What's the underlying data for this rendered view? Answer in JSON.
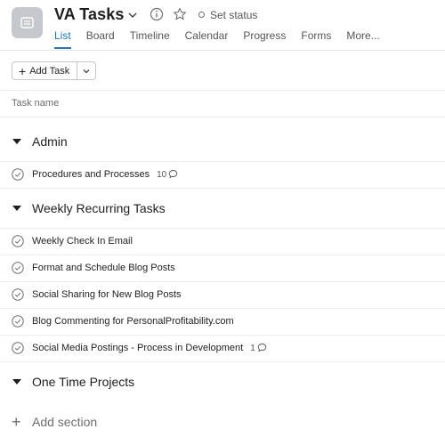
{
  "project": {
    "title": "VA Tasks",
    "set_status": "Set status"
  },
  "tabs": [
    {
      "label": "List",
      "active": true
    },
    {
      "label": "Board"
    },
    {
      "label": "Timeline"
    },
    {
      "label": "Calendar"
    },
    {
      "label": "Progress"
    },
    {
      "label": "Forms"
    },
    {
      "label": "More..."
    }
  ],
  "toolbar": {
    "add_task_label": "Add Task"
  },
  "list": {
    "column_header": "Task name"
  },
  "sections": [
    {
      "title": "Admin",
      "tasks": [
        {
          "name": "Procedures and Processes",
          "comments": "10"
        }
      ]
    },
    {
      "title": "Weekly Recurring Tasks",
      "tasks": [
        {
          "name": "Weekly Check In Email"
        },
        {
          "name": "Format and Schedule Blog Posts"
        },
        {
          "name": "Social Sharing for New Blog Posts"
        },
        {
          "name": "Blog Commenting for PersonalProfitability.com"
        },
        {
          "name": "Social Media Postings - Process in Development",
          "comments": "1"
        }
      ]
    },
    {
      "title": "One Time Projects",
      "tasks": []
    }
  ],
  "footer": {
    "add_section_label": "Add section"
  },
  "icons": {
    "project": "list-project-icon",
    "title_menu": "chevron-down-icon",
    "info": "info-icon",
    "favorite": "star-icon",
    "status": "status-circle-icon",
    "add": "plus-icon",
    "dropdown": "chevron-down-icon",
    "section_toggle": "caret-down-icon",
    "task_complete": "check-circle-icon",
    "comments": "comment-bubble-icon"
  },
  "colors": {
    "accent": "#1f76c2",
    "project_icon_bg": "#c5c8cc"
  }
}
